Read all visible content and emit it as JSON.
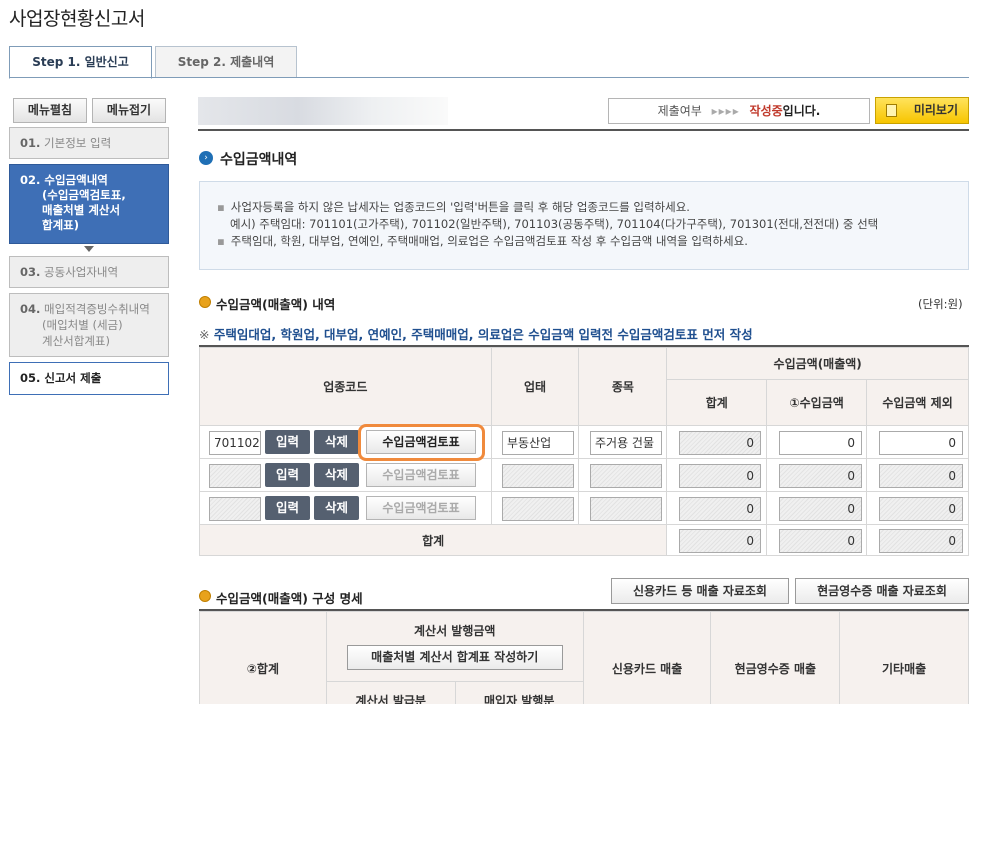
{
  "page": {
    "title": "사업장현황신고서"
  },
  "tabs": [
    {
      "label": "Step 1. 일반신고",
      "active": true
    },
    {
      "label": "Step 2. 제출내역",
      "active": false
    }
  ],
  "menu": {
    "expand_label": "메뉴펼침",
    "collapse_label": "메뉴접기"
  },
  "steps": [
    {
      "num": "01.",
      "label": "기본정보 입력"
    },
    {
      "num": "02.",
      "label": "수입금액내역",
      "sub": [
        "(수입금액검토표,",
        "매출처별 계산서",
        "합계표)"
      ]
    },
    {
      "num": "03.",
      "label": "공동사업자내역"
    },
    {
      "num": "04.",
      "label": "매입적격증빙수취내역",
      "sub": [
        "(매입처별 (세금)",
        "계산서합계표)"
      ]
    },
    {
      "num": "05.",
      "label": "신고서 제출"
    }
  ],
  "status": {
    "label": "제출여부",
    "arrows": "▸▸▸▸",
    "state": "작성중",
    "suffix": "입니다."
  },
  "preview_label": "미리보기",
  "section": {
    "title": "수입금액내역",
    "info": [
      "사업자등록을 하지 않은 납세자는 업종코드의 '입력'버튼을 클릭 후 해당 업종코드를 입력하세요.",
      "예시) 주택임대: 701101(고가주택), 701102(일반주택), 701103(공동주택), 701104(다가구주택), 701301(전대,전전대) 중 선택",
      "주택임대, 학원, 대부업, 연예인, 주택매매업, 의료업은 수입금액검토표 작성 후 수입금액 내역을 입력하세요."
    ]
  },
  "revenue": {
    "title": "수입금액(매출액) 내역",
    "unit": "(단위:원)",
    "notice_mark": "※",
    "notice": "주택임대업, 학원업, 대부업, 연예인, 주택매매업, 의료업은 수입금액 입력전 수입금액검토표 먼저 작성",
    "headers": {
      "code": "업종코드",
      "biz_type": "업태",
      "item": "종목",
      "revenue_group": "수입금액(매출액)",
      "sum": "합계",
      "amount": "①수입금액",
      "excluded": "수입금액 제외"
    },
    "buttons": {
      "input": "입력",
      "delete": "삭제",
      "review": "수입금액검토표"
    },
    "rows": [
      {
        "code": "701102",
        "biz_type": "부동산업",
        "item": "주거용 건물",
        "sum": "0",
        "amount": "0",
        "excluded": "0"
      },
      {
        "code": "",
        "biz_type": "",
        "item": "",
        "sum": "0",
        "amount": "0",
        "excluded": "0"
      },
      {
        "code": "",
        "biz_type": "",
        "item": "",
        "sum": "0",
        "amount": "0",
        "excluded": "0"
      }
    ],
    "total": {
      "label": "합계",
      "sum": "0",
      "amount": "0",
      "excluded": "0"
    }
  },
  "composition": {
    "title": "수입금액(매출액) 구성 명세",
    "btn_card": "신용카드 등 매출 자료조회",
    "btn_cash": "현금영수증 매출 자료조회",
    "headers": {
      "total": "②합계",
      "invoice_group": "계산서 발행금액",
      "invoice_btn": "매출처별 계산서 합계표 작성하기",
      "invoice_issued": "계산서 발급분",
      "buyer_issued": "매입자 발행분",
      "card": "신용카드 매출",
      "cash": "현금영수증 매출",
      "other": "기타매출"
    }
  }
}
